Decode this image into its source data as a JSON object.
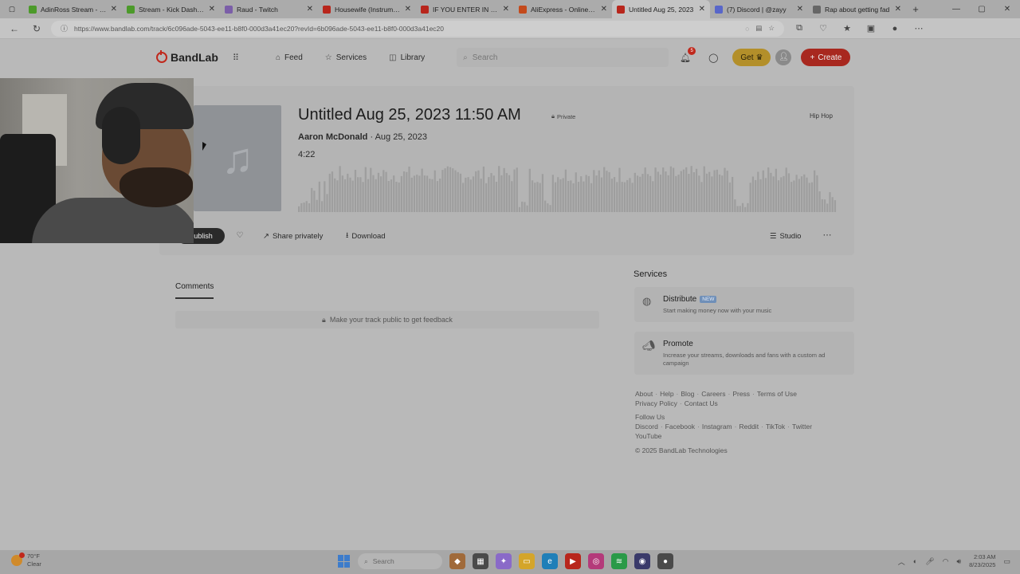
{
  "browser": {
    "tabs": [
      {
        "label": "AdinRoss Stream - Wa",
        "color": "#4c9a2a",
        "icon": "kick-icon"
      },
      {
        "label": "Stream - Kick Dashbo",
        "color": "#4c9a2a",
        "icon": "kick-icon"
      },
      {
        "label": "Raud - Twitch",
        "color": "#7b5ea8",
        "icon": "twitch-icon"
      },
      {
        "label": "Housewife (Instrument",
        "color": "#b8261c",
        "icon": "youtube-icon"
      },
      {
        "label": "IF YOU ENTER IN CLUE",
        "color": "#b8261c",
        "icon": "youtube-icon"
      },
      {
        "label": "AliExpress - Online Sh",
        "color": "#c44a1c",
        "icon": "aliexpress-icon"
      },
      {
        "label": "Untitled Aug 25, 2023",
        "color": "#b8261c",
        "icon": "bandlab-icon",
        "active": true
      },
      {
        "label": "(7) Discord | @zayy",
        "color": "#5866c9",
        "icon": "discord-icon"
      },
      {
        "label": "Rap about getting fad",
        "color": "#666666",
        "icon": "globe-icon"
      }
    ],
    "url": "https://www.bandlab.com/track/6c096ade-5043-ee11-b8f0-000d3a41ec20?revId=6b096ade-5043-ee11-b8f0-000d3a41ec20"
  },
  "nav": {
    "logo": "BandLab",
    "feed": "Feed",
    "services": "Services",
    "library": "Library",
    "search_placeholder": "Search",
    "notif_count": "5",
    "get": "Get",
    "create": "Create"
  },
  "track": {
    "title": "Untitled Aug 25, 2023 11:50 AM",
    "visibility": "Private",
    "genre": "Hip Hop",
    "artist": "Aaron McDonald",
    "date": "· Aug 25, 2023",
    "duration": "4:22",
    "actions": {
      "publish": "Publish",
      "share": "Share privately",
      "download": "Download",
      "studio": "Studio"
    }
  },
  "comments": {
    "tab": "Comments",
    "empty_msg": "Make your track public to get feedback"
  },
  "services_panel": {
    "heading": "Services",
    "items": [
      {
        "title": "Distribute",
        "badge": "NEW",
        "desc": "Start making money now with your music"
      },
      {
        "title": "Promote",
        "badge": "",
        "desc": "Increase your streams, downloads and fans with a custom ad campaign"
      }
    ]
  },
  "footer": {
    "links1": [
      "About",
      "Help",
      "Blog",
      "Careers",
      "Press",
      "Terms of Use"
    ],
    "links2": [
      "Privacy Policy",
      "Contact Us"
    ],
    "follow": "Follow Us",
    "social1": [
      "Discord",
      "Facebook",
      "Instagram",
      "Reddit",
      "TikTok",
      "Twitter"
    ],
    "social2": [
      "YouTube"
    ],
    "copyright": "© 2025 BandLab Technologies"
  },
  "taskbar": {
    "temp": "70°F",
    "weather": "Clear",
    "search": "Search",
    "time": "2:03 AM",
    "date": "8/23/2025"
  }
}
